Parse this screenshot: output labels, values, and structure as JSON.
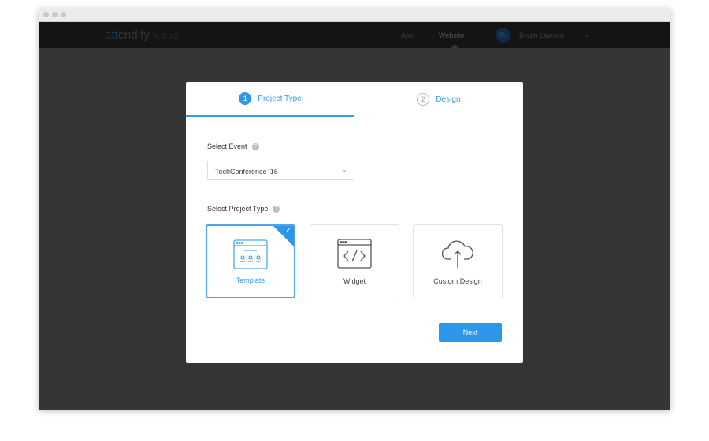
{
  "nav": {
    "logo_a": "a",
    "logo_tt": "tt",
    "logo_rest": "endify",
    "logo_sub": "hub v2",
    "items": [
      "App",
      "Website"
    ],
    "user_initials": "BL",
    "user_name": "Bryan Lawson"
  },
  "wizard": {
    "steps": [
      {
        "num": "1",
        "label": "Project Type",
        "active": true
      },
      {
        "num": "2",
        "label": "Design",
        "active": false
      }
    ],
    "select_event_label": "Select Event",
    "event_value": "TechConference '16",
    "project_type_label": "Select Project Type",
    "types": [
      {
        "label": "Template",
        "icon": "template-icon",
        "selected": true
      },
      {
        "label": "Widget",
        "icon": "code-window-icon",
        "selected": false
      },
      {
        "label": "Custom Design",
        "icon": "cloud-upload-icon",
        "selected": false
      }
    ],
    "next_label": "Next"
  },
  "colors": {
    "accent": "#2d96e8"
  }
}
